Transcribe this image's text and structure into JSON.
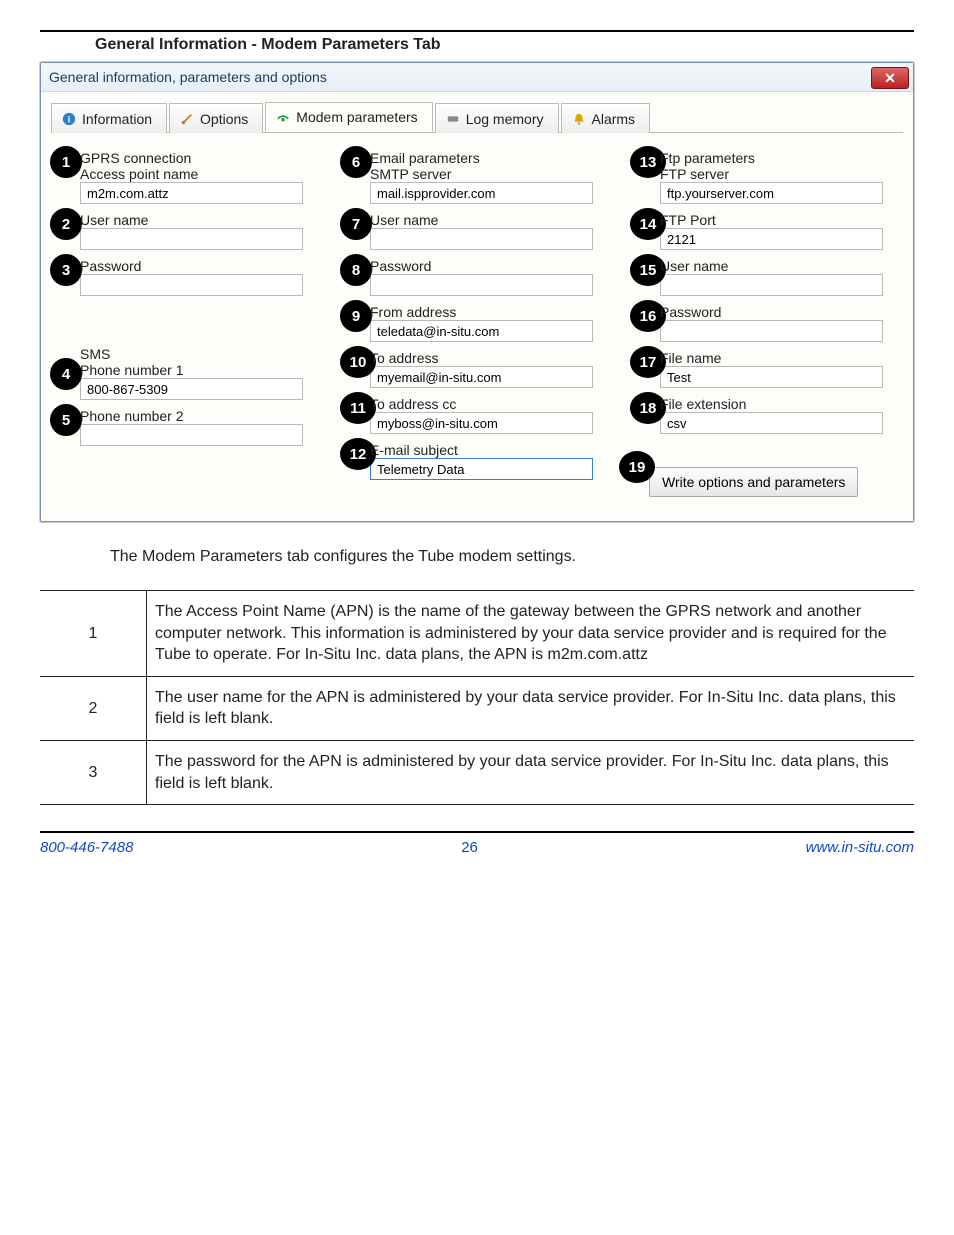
{
  "section_title": "General Information - Modem Parameters Tab",
  "window_title": "General information, parameters and options",
  "tabs": {
    "info": "Information",
    "options": "Options",
    "modem": "Modem parameters",
    "log": "Log memory",
    "alarms": "Alarms"
  },
  "gprs": {
    "heading": "GPRS connection",
    "apn_label": "Access point name",
    "apn_value": "m2m.com.attz",
    "user_label": "User name",
    "user_value": "",
    "pass_label": "Password",
    "pass_value": ""
  },
  "sms": {
    "heading": "SMS",
    "p1_label": "Phone number 1",
    "p1_value": "800-867-5309",
    "p2_label": "Phone number 2",
    "p2_value": ""
  },
  "email": {
    "heading": "Email parameters",
    "smtp_label": "SMTP server",
    "smtp_value": "mail.ispprovider.com",
    "user_label": "User name",
    "user_value": "",
    "pass_label": "Password",
    "pass_value": "",
    "from_label": "From address",
    "from_value": "teledata@in-situ.com",
    "to_label": "To address",
    "to_value": "myemail@in-situ.com",
    "cc_label": "To address cc",
    "cc_value": "myboss@in-situ.com",
    "subject_label": "E-mail subject",
    "subject_value": "Telemetry Data"
  },
  "ftp": {
    "heading": "Ftp parameters",
    "server_label": "FTP server",
    "server_value": "ftp.yourserver.com",
    "port_label": "FTP Port",
    "port_value": "2121",
    "user_label": "User name",
    "user_value": "",
    "pass_label": "Password",
    "pass_value": "",
    "file_label": "File name",
    "file_value": "Test",
    "ext_label": "File extension",
    "ext_value": "csv"
  },
  "write_button": "Write options and parameters",
  "badges": [
    "1",
    "2",
    "3",
    "4",
    "5",
    "6",
    "7",
    "8",
    "9",
    "10",
    "11",
    "12",
    "13",
    "14",
    "15",
    "16",
    "17",
    "18",
    "19"
  ],
  "description": "The Modem Parameters tab configures the Tube modem settings.",
  "table_rows": [
    {
      "n": "1",
      "text": "The Access Point Name (APN) is the name of the gateway between the GPRS network and another computer network. This information is administered by your data service provider and is required for the Tube to operate. For In-Situ Inc. data plans, the APN is m2m.com.attz"
    },
    {
      "n": "2",
      "text": "The user name for the APN is administered by your data service provider. For In-Situ Inc. data plans, this field is left blank."
    },
    {
      "n": "3",
      "text": "The password for the APN is administered by your data service provider. For In-Situ Inc. data plans, this field is left blank."
    }
  ],
  "footer": {
    "phone": "800-446-7488",
    "page": "26",
    "url": "www.in-situ.com"
  }
}
